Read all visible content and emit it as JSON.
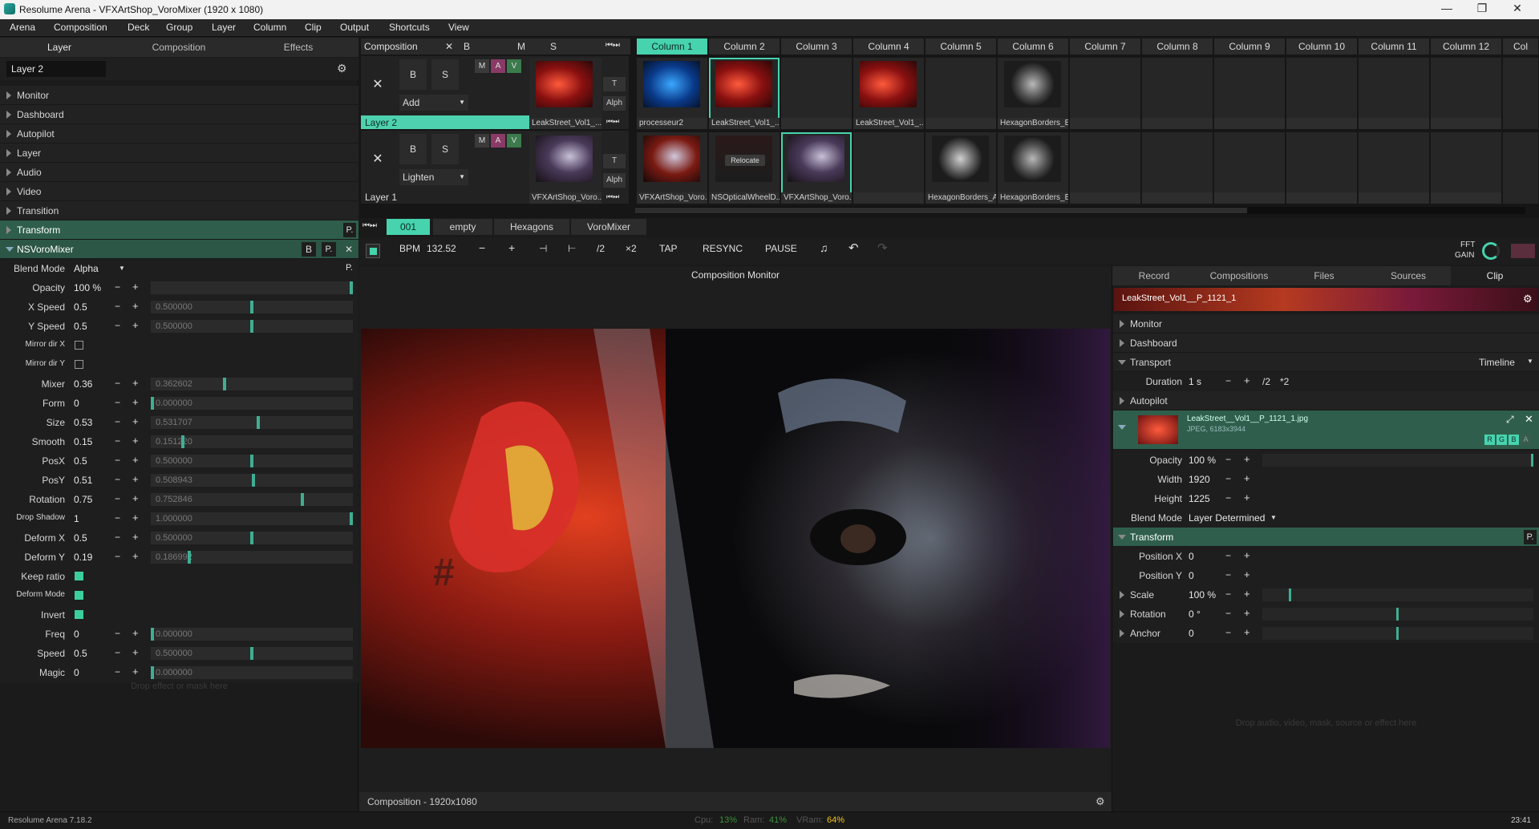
{
  "window": {
    "title": "Resolume Arena - VFXArtShop_VoroMixer (1920 x 1080)"
  },
  "menu": [
    "Arena",
    "Composition",
    "Deck",
    "Group",
    "Layer",
    "Column",
    "Clip",
    "Output",
    "Shortcuts",
    "View"
  ],
  "left_tabs": [
    "Layer",
    "Composition",
    "Effects"
  ],
  "layer_name": "Layer 2",
  "layer_sections": [
    "Monitor",
    "Dashboard",
    "Autopilot",
    "Layer",
    "Audio",
    "Video",
    "Transition"
  ],
  "transform_label": "Transform",
  "transform_p": "P.",
  "effect": {
    "name": "NSVoroMixer",
    "btn_b": "B",
    "btn_p": "P.",
    "btn_x": "✕",
    "blend_label": "Blend Mode",
    "blend_value": "Alpha",
    "blend_p": "P.",
    "params": [
      {
        "label": "Opacity",
        "value": "100 %",
        "slider_text": "",
        "fill": 1.0
      },
      {
        "label": "X Speed",
        "value": "0.5",
        "slider_text": "0.500000",
        "fill": 0.5
      },
      {
        "label": "Y Speed",
        "value": "0.5",
        "slider_text": "0.500000",
        "fill": 0.5
      },
      {
        "label": "Mirror dir X",
        "check": false
      },
      {
        "label": "Mirror dir Y",
        "check": false
      },
      {
        "label": "Mixer",
        "value": "0.36",
        "slider_text": "0.362602",
        "fill": 0.362602
      },
      {
        "label": "Form",
        "value": "0",
        "slider_text": "0.000000",
        "fill": 0.0
      },
      {
        "label": "Size",
        "value": "0.53",
        "slider_text": "0.531707",
        "fill": 0.531707
      },
      {
        "label": "Smooth",
        "value": "0.15",
        "slider_text": "0.151220",
        "fill": 0.15122
      },
      {
        "label": "PosX",
        "value": "0.5",
        "slider_text": "0.500000",
        "fill": 0.5
      },
      {
        "label": "PosY",
        "value": "0.51",
        "slider_text": "0.508943",
        "fill": 0.508943
      },
      {
        "label": "Rotation",
        "value": "0.75",
        "slider_text": "0.752846",
        "fill": 0.752846
      },
      {
        "label": "Drop Shadow",
        "value": "1",
        "slider_text": "1.000000",
        "fill": 1.0
      },
      {
        "label": "Deform X",
        "value": "0.5",
        "slider_text": "0.500000",
        "fill": 0.5
      },
      {
        "label": "Deform Y",
        "value": "0.19",
        "slider_text": "0.186992",
        "fill": 0.186992
      },
      {
        "label": "Keep ratio",
        "check": true
      },
      {
        "label": "Deform Mode",
        "check": true
      },
      {
        "label": "Invert",
        "check": true
      },
      {
        "label": "Freq",
        "value": "0",
        "slider_text": "0.000000",
        "fill": 0.0
      },
      {
        "label": "Speed",
        "value": "0.5",
        "slider_text": "0.500000",
        "fill": 0.5
      },
      {
        "label": "Magic",
        "value": "0",
        "slider_text": "0.000000",
        "fill": 0.0
      }
    ]
  },
  "drop_hint_left": "Drop effect or mask here",
  "composition_bar": {
    "label": "Composition",
    "x": "✕",
    "b": "B",
    "m": "M",
    "s": "S"
  },
  "columns": [
    "Column 1",
    "Column 2",
    "Column 3",
    "Column 4",
    "Column 5",
    "Column 6",
    "Column 7",
    "Column 8",
    "Column 9",
    "Column 10",
    "Column 11",
    "Column 12",
    "Col"
  ],
  "layers": [
    {
      "name": "Layer 2",
      "blend": "Add",
      "b": "B",
      "s": "S",
      "x": "✕",
      "m": "M",
      "a": "A",
      "v": "V",
      "t": "T",
      "alph": "Alph",
      "active_clip": "LeakStreet_Vol1_...",
      "clips": [
        "processeur2",
        "LeakStreet_Vol1_...",
        "",
        "LeakStreet_Vol1_...",
        "",
        "HexagonBorders_B"
      ]
    },
    {
      "name": "Layer 1",
      "blend": "Lighten",
      "b": "B",
      "s": "S",
      "x": "✕",
      "m": "M",
      "a": "A",
      "v": "V",
      "t": "T",
      "alph": "Alph",
      "active_clip": "VFXArtShop_Voro...",
      "clips": [
        "VFXArtShop_Voro...",
        "NSOpticalWheelD...",
        "VFXArtShop_Voro...",
        "",
        "HexagonBorders_A",
        "HexagonBorders_B"
      ]
    }
  ],
  "relocate": "Relocate",
  "deck_tabs": [
    "001",
    "empty",
    "Hexagons",
    "VoroMixer"
  ],
  "toolbar": {
    "bpm_label": "BPM",
    "bpm": "132.52",
    "minus": "−",
    "plus": "+",
    "half": "/2",
    "double": "×2",
    "tap": "TAP",
    "resync": "RESYNC",
    "pause": "PAUSE",
    "fft": "FFT",
    "gain": "GAIN"
  },
  "monitor": {
    "title": "Composition Monitor",
    "footer": "Composition - 1920x1080"
  },
  "right_tabs": [
    "Record",
    "Compositions",
    "Files",
    "Sources",
    "Clip"
  ],
  "clip_name": "LeakStreet_Vol1__P_1121_1",
  "right_sections": {
    "monitor": "Monitor",
    "dashboard": "Dashboard",
    "transport": "Transport",
    "timeline": "Timeline",
    "autopilot": "Autopilot",
    "transform": "Transform",
    "transform_p": "P."
  },
  "duration": {
    "label": "Duration",
    "value": "1 s",
    "minus": "−",
    "plus": "+",
    "half": "/2",
    "double": "*2"
  },
  "file": {
    "name": "LeakStreet__Vol1__P_1121_1.jpg",
    "info": "JPEG, 6183x3944",
    "r": "R",
    "g": "G",
    "b": "B",
    "a": "A"
  },
  "clip_params": [
    {
      "label": "Opacity",
      "value": "100 %"
    },
    {
      "label": "Width",
      "value": "1920"
    },
    {
      "label": "Height",
      "value": "1225"
    },
    {
      "label": "Blend Mode",
      "value": "Layer Determined"
    }
  ],
  "transform_params": [
    {
      "label": "Position X",
      "value": "0"
    },
    {
      "label": "Position Y",
      "value": "0"
    },
    {
      "label": "Scale",
      "value": "100 %",
      "fill": 0.1
    },
    {
      "label": "Rotation",
      "value": "0 °",
      "fill": 0.5
    },
    {
      "label": "Anchor",
      "value": "0",
      "fill": 0.5
    }
  ],
  "drop_hint_right": "Drop audio, video, mask, source or effect here",
  "status": {
    "version": "Resolume Arena 7.18.2",
    "cpu_label": "Cpu:",
    "cpu": "13%",
    "ram_label": "Ram:",
    "ram": "41%",
    "vram_label": "VRam:",
    "vram": "64%",
    "time": "23:41"
  },
  "colors": {
    "accent": "#46d3ae",
    "panel": "#1e1e1e",
    "green_section": "#2f5f4c",
    "vram": "#f0c419",
    "cpu": "#3c8f3c"
  }
}
